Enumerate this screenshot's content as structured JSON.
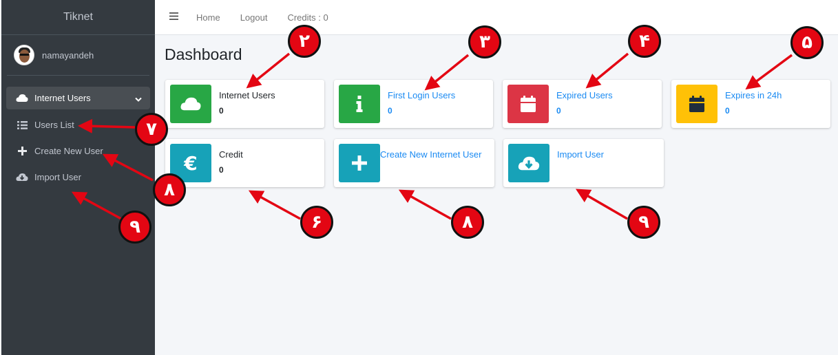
{
  "sidebar": {
    "brand": "Tiknet",
    "user_name": "namayandeh",
    "menu": {
      "label": "Internet Users",
      "icon": "cloud-icon",
      "children": [
        {
          "label": "Users List",
          "icon": "list-icon"
        },
        {
          "label": "Create New User",
          "icon": "plus-icon"
        },
        {
          "label": "Import User",
          "icon": "cloud-download-icon"
        }
      ]
    }
  },
  "topbar": {
    "links": [
      "Home",
      "Logout",
      "Credits : 0"
    ]
  },
  "page": {
    "title": "Dashboard"
  },
  "cards": [
    {
      "label": "Internet Users",
      "value": "0",
      "icon": "cloud-icon",
      "color": "#28a745"
    },
    {
      "label": "First Login Users",
      "value": "0",
      "icon": "info-icon",
      "color": "#28a745"
    },
    {
      "label": "Expired Users",
      "value": "0",
      "icon": "calendar-icon",
      "color": "#dc3545"
    },
    {
      "label": "Expires in 24h",
      "value": "0",
      "icon": "calendar-icon",
      "color": "#ffc107"
    },
    {
      "label": "Credit",
      "value": "0",
      "icon": "euro-icon",
      "color": "#17a2b8"
    },
    {
      "label": "Create New Internet User",
      "icon": "plus-icon",
      "color": "#17a2b8"
    },
    {
      "label": "Import User",
      "icon": "cloud-download-icon",
      "color": "#17a2b8"
    }
  ],
  "annotations": [
    "۲",
    "۳",
    "۴",
    "۵",
    "۶",
    "۷",
    "۸",
    "۸",
    "۹",
    "۹"
  ],
  "colors": {
    "sidebar": "#343a40",
    "link": "#1a8af2",
    "marker": "#e30613"
  }
}
